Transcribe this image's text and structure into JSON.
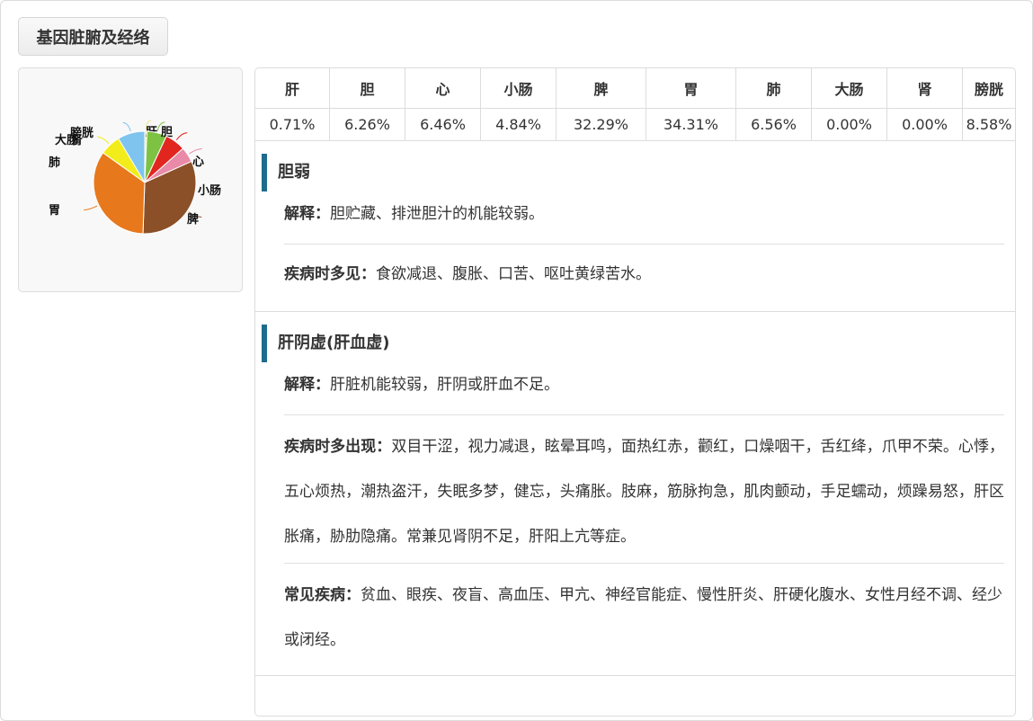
{
  "header": {
    "title": "基因脏腑及经络"
  },
  "organs": {
    "headers": [
      "肝",
      "胆",
      "心",
      "小肠",
      "脾",
      "胃",
      "肺",
      "大肠",
      "肾",
      "膀胱"
    ],
    "values": [
      "0.71%",
      "6.26%",
      "6.46%",
      "4.84%",
      "32.29%",
      "34.31%",
      "6.56%",
      "0.00%",
      "0.00%",
      "8.58%"
    ]
  },
  "chart_data": {
    "type": "pie",
    "categories": [
      "肝",
      "胆",
      "心",
      "小肠",
      "脾",
      "胃",
      "肺",
      "大肠",
      "肾",
      "膀胱"
    ],
    "values": [
      0.71,
      6.26,
      6.46,
      4.84,
      32.29,
      34.31,
      6.56,
      0.0,
      0.0,
      8.58
    ],
    "colors": [
      "#f0e88a",
      "#7dc242",
      "#e0261f",
      "#e88aa8",
      "#8b5028",
      "#e8781c",
      "#f2ec1a",
      "#eeeeee",
      "#dddddd",
      "#7ec4ee"
    ]
  },
  "sections": [
    {
      "title": "胆弱",
      "rows": [
        {
          "label": "解释：",
          "text": "胆贮藏、排泄胆汁的机能较弱。"
        },
        {
          "label": "疾病时多见：",
          "text": "食欲减退、腹胀、口苦、呕吐黄绿苦水。"
        }
      ]
    },
    {
      "title": "肝阴虚(肝血虚)",
      "rows": [
        {
          "label": "解释：",
          "text": "肝脏机能较弱，肝阴或肝血不足。"
        },
        {
          "label": "疾病时多出现：",
          "text": "双目干涩，视力减退，眩晕耳鸣，面热红赤，颧红，口燥咽干，舌红绛，爪甲不荣。心悸，五心烦热，潮热盗汗，失眠多梦，健忘，头痛胀。肢麻，筋脉拘急，肌肉颤动，手足蠕动，烦躁易怒，肝区胀痛，胁肋隐痛。常兼见肾阴不足，肝阳上亢等症。"
        },
        {
          "label": "常见疾病：",
          "text": "贫血、眼疾、夜盲、高血压、甲亢、神经官能症、慢性肝炎、肝硬化腹水、女性月经不调、经少或闭经。"
        }
      ]
    }
  ]
}
